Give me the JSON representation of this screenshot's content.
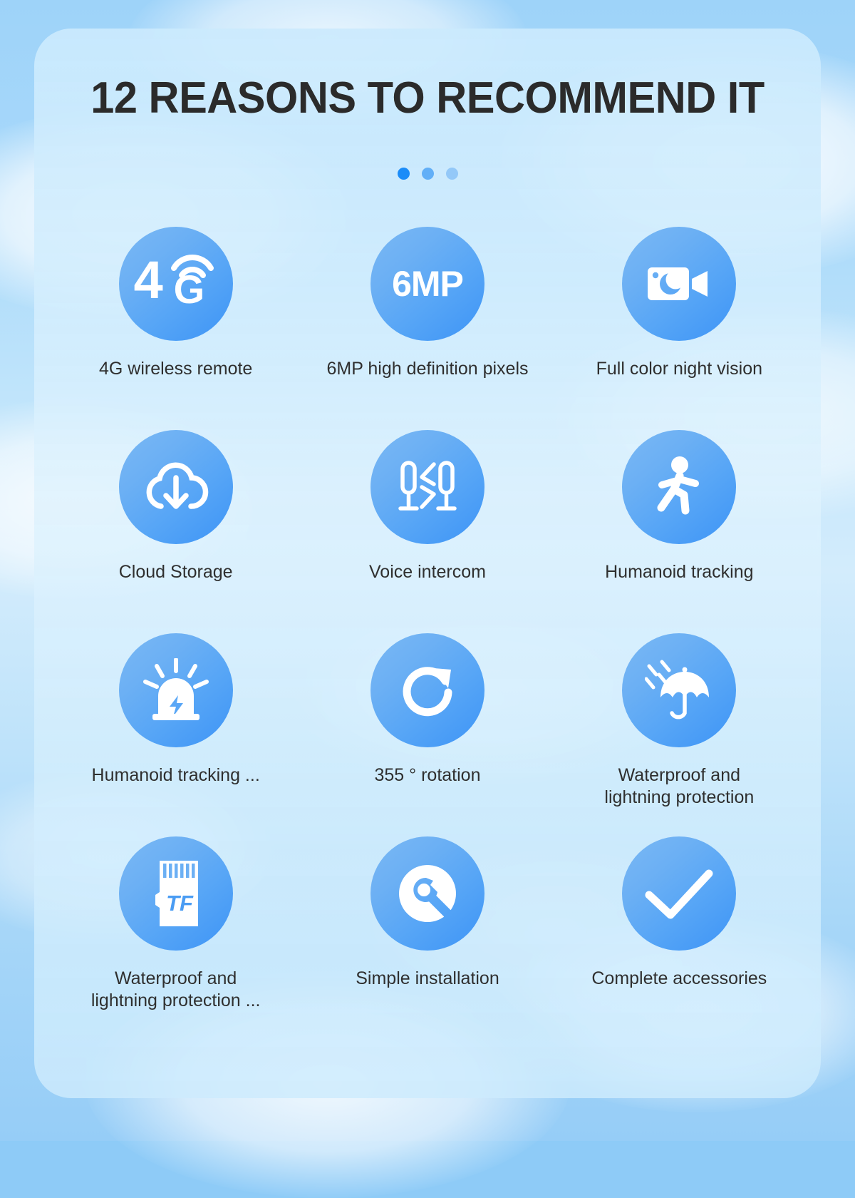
{
  "page": {
    "title": "12 REASONS TO RECOMMEND IT",
    "background_color": "#8ecbf7",
    "card_color": "#cbeafd",
    "accent_color": "#3d94f7",
    "text_color": "#2f2f2f"
  },
  "pagination": {
    "dots": [
      {
        "name": "dot-1",
        "state": "active",
        "color": "#1b8cf8"
      },
      {
        "name": "dot-2",
        "state": "inactive",
        "color": "#62aff7"
      },
      {
        "name": "dot-3",
        "state": "inactive",
        "color": "#93c8f8"
      }
    ]
  },
  "features": [
    {
      "icon": "4g-signal-icon",
      "glyph_text": "4",
      "glyph_sub": "G",
      "label": "4G wireless remote"
    },
    {
      "icon": "6mp-resolution-icon",
      "glyph_text": "6MP",
      "label": "6MP high definition pixels"
    },
    {
      "icon": "night-vision-camera-icon",
      "label": "Full color night vision"
    },
    {
      "icon": "cloud-download-icon",
      "label": "Cloud Storage"
    },
    {
      "icon": "two-way-microphone-icon",
      "label": "Voice intercom"
    },
    {
      "icon": "walking-person-icon",
      "label": "Humanoid tracking"
    },
    {
      "icon": "alarm-siren-icon",
      "label": "Humanoid tracking ..."
    },
    {
      "icon": "rotation-arrow-icon",
      "label": "355 ° rotation"
    },
    {
      "icon": "umbrella-rain-icon",
      "label": "Waterproof and\nlightning protection"
    },
    {
      "icon": "tf-memory-card-icon",
      "glyph_text": "TF",
      "label": "Waterproof and\nlightning protection ..."
    },
    {
      "icon": "wrench-tool-icon",
      "label": "Simple installation"
    },
    {
      "icon": "checkmark-icon",
      "label": "Complete accessories"
    }
  ]
}
